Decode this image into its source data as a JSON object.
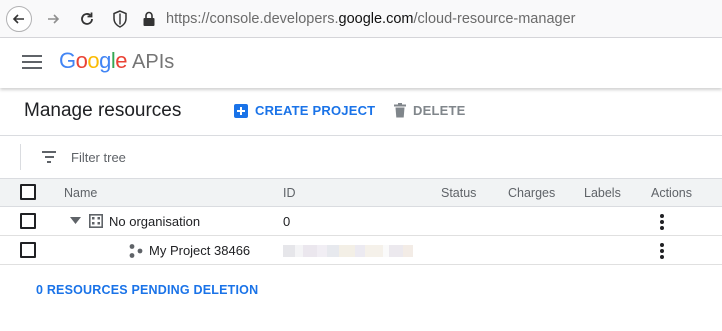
{
  "browser": {
    "url_prefix": "https://console.developers.",
    "url_domain": "google.com",
    "url_path": "/cloud-resource-manager"
  },
  "header": {
    "logo_letters": [
      {
        "ch": "G",
        "color": "#4285f4"
      },
      {
        "ch": "o",
        "color": "#ea4335"
      },
      {
        "ch": "o",
        "color": "#fbbc05"
      },
      {
        "ch": "g",
        "color": "#4285f4"
      },
      {
        "ch": "l",
        "color": "#34a853"
      },
      {
        "ch": "e",
        "color": "#ea4335"
      }
    ],
    "logo_suffix": "APIs"
  },
  "toolbar": {
    "title": "Manage resources",
    "create_label": "CREATE PROJECT",
    "delete_label": "DELETE"
  },
  "filter": {
    "placeholder": "Filter tree"
  },
  "table": {
    "columns": {
      "name": "Name",
      "id": "ID",
      "status": "Status",
      "charges": "Charges",
      "labels": "Labels",
      "actions": "Actions"
    },
    "rows": [
      {
        "name": "No organisation",
        "id": "0"
      },
      {
        "name": "My Project 38466",
        "id": ""
      }
    ]
  },
  "footer": {
    "pending_label": "0 RESOURCES PENDING DELETION"
  },
  "colors": {
    "accent": "#1a73e8",
    "muted": "#80868b"
  }
}
